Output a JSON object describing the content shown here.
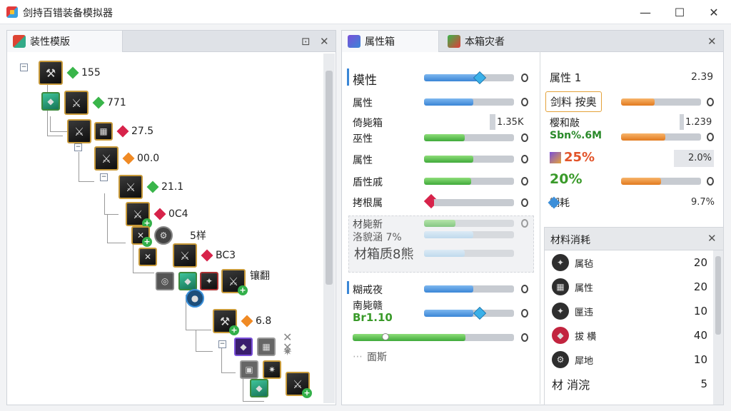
{
  "window": {
    "title": "剑持百错装备模拟器",
    "min": "—",
    "max": "☐",
    "close": "✕"
  },
  "left_panel": {
    "tab": "装性模版",
    "pin": "⊡",
    "close": "✕",
    "nodes": [
      {
        "label": "155",
        "gem": "green"
      },
      {
        "label": "771",
        "gem": "green"
      },
      {
        "label": "27.5",
        "gem": "red"
      },
      {
        "label": "00.0",
        "gem": "orange"
      },
      {
        "label": "21.1",
        "gem": "green"
      },
      {
        "label": "0C4",
        "gem": "red"
      },
      {
        "label": "5样"
      },
      {
        "label": "BC3",
        "gem": "red"
      },
      {
        "label": "镶翻"
      },
      {
        "label": "6.8",
        "gem": "orange"
      }
    ]
  },
  "mid_panel": {
    "tabs": [
      "属性箱",
      "本箱灾者"
    ],
    "rows": [
      {
        "label": "模性",
        "bar": "blue",
        "level": 0.6
      },
      {
        "label": "属性",
        "bar": "blue",
        "level": 0.55
      },
      {
        "label": "倚毙箱",
        "value": "1.35K"
      },
      {
        "label": "巫性",
        "bar": "green",
        "level": 0.45
      },
      {
        "label": "属性",
        "bar": "green",
        "level": 0.55
      },
      {
        "label": "盾性戚",
        "bar": "green",
        "level": 0.52
      },
      {
        "label": "拷根属",
        "bar": "red",
        "level": 0.02
      },
      {
        "label": "材毙新",
        "bar": "green",
        "level": 0.35
      },
      {
        "label": "洛貌涵 7%",
        "bar": "lightblue",
        "level": 0.55
      },
      {
        "label": "材箱质8熊",
        "bar": "lightblue",
        "level": 0.45
      },
      {
        "label": "糊戒夜",
        "bar": "blue",
        "level": 0.55
      },
      {
        "label": "南毙赣",
        "value2": "Br1.10",
        "bar": "blue",
        "level": 0.55
      },
      {
        "label": "",
        "bar": "green",
        "level": 0.7
      },
      {
        "label": "面斯"
      }
    ]
  },
  "right_top": {
    "rows": [
      {
        "label": "属性 1",
        "value": "2.39"
      },
      {
        "label": "剑料 按奥",
        "bar": "orange",
        "level": 0.42
      },
      {
        "label": "樱和敲",
        "value": "1.239"
      },
      {
        "label": "Sbn%.6M",
        "bar": "orange",
        "level": 0.55
      },
      {
        "label": "25%",
        "value": "2.0%"
      },
      {
        "label": "20%",
        "bar": "orange",
        "level": 0.5
      },
      {
        "label": "糊耗",
        "value": "9.7%"
      }
    ]
  },
  "right_bottom": {
    "title": "材料消耗",
    "close": "✕",
    "items": [
      {
        "label": "属毡",
        "count": "20"
      },
      {
        "label": "属性",
        "count": "20"
      },
      {
        "label": "匰违",
        "count": "10"
      },
      {
        "label": "拔 横",
        "count": "40"
      },
      {
        "label": "犀地",
        "count": "10"
      },
      {
        "label": "材 消浣",
        "count": "5"
      }
    ]
  },
  "colors": {
    "accent": "#3a86d6",
    "green": "#3faa3a",
    "orange": "#e27a1e",
    "red": "#d7234a"
  }
}
